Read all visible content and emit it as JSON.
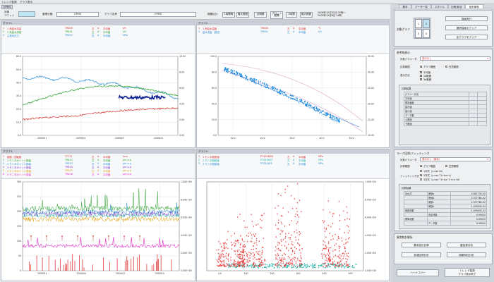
{
  "window": {
    "title": "トレンド監視 グラフ表示"
  },
  "menu": {
    "item1": "トレンド監視",
    "item2": "グラフ表示"
  },
  "tabs": [
    "基本",
    "データ一覧",
    "スタイル",
    "比較/組合",
    "統計解析"
  ],
  "toolbar": {
    "mode_label": "OPMS",
    "target_label1": "対象",
    "target_label2": "ユニット",
    "target_value": "",
    "group_label": "管理分類",
    "group_value": "OPMS",
    "graph_label": "グラフ名称",
    "graph_value": "OPMS",
    "period_label": "期間区分",
    "btn_1h": "1時間毎",
    "btn_latest": "最大範囲",
    "btn_all": "全期間",
    "btn_plot1": "プロット",
    "btn_plot2": "間隔",
    "btn_1h_b": "1時間",
    "btn_latest_b": "最大範囲",
    "date_from": "2008年12月31日 00時～",
    "date_to": "2009年12月8日 24時"
  },
  "graph1": {
    "title": "グラフ1",
    "legend": [
      {
        "no": "1",
        "name": "1 系給水流量",
        "code": "TR850",
        "axis": "左",
        "col": "A",
        "stat": "平均値",
        "unit": "t/h",
        "color": "#d0312d"
      },
      {
        "no": "2",
        "name": "2 系給水流量",
        "code": "TR851",
        "axis": "左",
        "col": "A",
        "stat": "平均値",
        "unit": "t/h",
        "color": "#2b9e2b"
      },
      {
        "no": "3",
        "name": "主蒸気圧力",
        "code": "TR852",
        "axis": "右",
        "col": "A",
        "stat": "平均値",
        "unit": "MPa",
        "color": "#2a8fd4"
      }
    ],
    "y_left": [
      "60.0",
      "50.0",
      "40.0",
      "30.0",
      "20.0",
      "10.0",
      "0.0"
    ],
    "y_right": [
      "10.00",
      "8.00",
      "6.00",
      "4.00",
      "2.00",
      "0.00"
    ],
    "x_ticks": [
      "2009/01",
      "2009/04",
      "2009/07",
      "2009/10"
    ]
  },
  "graph2": {
    "title": "グラフ2",
    "legend": [
      {
        "no": "1",
        "name": "1 系給水温度",
        "code": "TR800",
        "axis": "左",
        "col": "A",
        "stat": "平均値",
        "unit": "℃",
        "color": "#d0312d"
      },
      {
        "no": "2",
        "name": "給水流量（推定）",
        "code": "TR801",
        "axis": "左",
        "col": "A",
        "stat": "平均値",
        "unit": "t/h",
        "color": "#2a8fd4"
      }
    ],
    "y_left": [
      "100.0",
      "80.0",
      "60.0",
      "40.0",
      "20.0",
      "0.0"
    ],
    "y_right": [
      "35.00",
      "30.00",
      "25.00",
      "20.00",
      "15.00",
      "10.00"
    ],
    "x_ticks": [
      "10.0",
      "20.0",
      "30.0",
      "40.0",
      "50.0"
    ]
  },
  "graph3": {
    "title": "グラフ3",
    "legend": [
      {
        "no": "1",
        "name": "振動 / 回転数",
        "code": "TT727",
        "axis": "左",
        "col": "A",
        "stat": "平均値",
        "unit": "rpm",
        "color": "#d0312d"
      },
      {
        "no": "2",
        "name": "1 モニタポイント振幅",
        "code": "TR812",
        "axis": "左",
        "col": "A",
        "stat": "平均値",
        "unit": "μm p-p",
        "color": "#2b9e2b"
      },
      {
        "no": "3",
        "name": "2 モニタポイント振幅",
        "code": "TR813",
        "axis": "左",
        "col": "A",
        "stat": "平均値",
        "unit": "μm p-p",
        "color": "#2a8fd4"
      },
      {
        "no": "4",
        "name": "3 モニタポイント振幅",
        "code": "TR814",
        "axis": "左",
        "col": "A",
        "stat": "平均値",
        "unit": "μm p-p",
        "color": "#7a2ec9"
      },
      {
        "no": "5",
        "name": "4 モニタポイント振幅",
        "code": "TR815",
        "axis": "左",
        "col": "A",
        "stat": "平均値",
        "unit": "μm p-p",
        "color": "#e0a10e"
      },
      {
        "no": "6",
        "name": "5 モニタポイント振幅",
        "code": "TR816",
        "axis": "左",
        "col": "A",
        "stat": "平均値",
        "unit": "μm p-p",
        "color": "#e02fc7"
      }
    ],
    "y_left": [
      "300",
      "250",
      "200",
      "150",
      "100",
      "50",
      "0"
    ],
    "y_right": [
      "1.00E+04",
      "8.00E+03",
      "6.00E+03",
      "4.00E+03",
      "2.00E+03",
      "0.00E+00"
    ],
    "x_ticks": [
      "2009/01",
      "2009/04",
      "2009/07",
      "2009/10"
    ]
  },
  "graph4": {
    "title": "グラフ4",
    "legend": [
      {
        "no": "1",
        "name": "1 モニタ振動値",
        "code": "PT433ADD",
        "axis": "左",
        "col": "A",
        "stat": "平均値",
        "unit": "MPa",
        "color": "#d0312d"
      },
      {
        "no": "2",
        "name": "2 モニタ振動値",
        "code": "PT433AGT",
        "axis": "左",
        "col": "A",
        "stat": "平均値",
        "unit": "MPa",
        "color": "#1ab3a6"
      },
      {
        "no": "3",
        "name": "3 モニタ振動値",
        "code": "PT433AFF",
        "axis": "左",
        "col": "A",
        "stat": "平均値",
        "unit": "MPa",
        "color": "#2a8fd4"
      }
    ],
    "y_right": [
      "1.00E+04",
      "8.00E+03",
      "6.00E+03",
      "4.00E+03",
      "2.00E+03",
      "0.00E+00"
    ],
    "x_ticks": [
      "0.0",
      "100",
      "200",
      "300",
      "400",
      "500"
    ]
  },
  "right": {
    "target_graph_label": "対象グラフ",
    "graph_nums": [
      "1",
      "2",
      "3",
      "4"
    ],
    "btn_search": "描画実行",
    "btn_clear_sel": "選択描画をクリア",
    "btn_clear_all": "全グラフをクリア",
    "ref_title": "参考線表示",
    "ref_param_label": "対象パラメータ",
    "ref_param_value": "表示なし",
    "calc_label": "計算期間",
    "calc_opt1": "グラフ範囲",
    "calc_opt2": "任意期間",
    "method_label": "表示方法",
    "method_opt1": "平均値",
    "method_opt2": "2σ範囲",
    "method_opt3": "3σ範囲",
    "calc_result_title": "計算結果",
    "calc_rows": [
      [
        "パラメータ名",
        "",
        ""
      ],
      [
        "平均値",
        "",
        ""
      ],
      [
        "標準偏差",
        "",
        ""
      ],
      [
        "最大値",
        "",
        ""
      ],
      [
        "最小値",
        "",
        ""
      ],
      [
        "データ数",
        "",
        ""
      ],
      [
        "上限値",
        "",
        ""
      ],
      [
        "下限値",
        "",
        ""
      ]
    ],
    "fit_title": "ヨーク回帰/フィッティング",
    "fit_param_label": "対象パラメータ",
    "fit_param_value": "表示なし（無効）",
    "fit_calc_label": "計算期間",
    "fit_calc_opt1": "グラフ範囲",
    "fit_calc_opt2": "任意期間",
    "fit_method_label": "フィッティング式",
    "fit_method_opt1": "1次式（y=ax+b）",
    "fit_method_opt2": "2次式（y=ax^2+bx+c）",
    "fit_method_opt3": "3次式（y=ax^3+bx^2+cx+d）",
    "fit_result_title": "計算結果",
    "fit_rows": [
      [
        "近似式",
        "係数a",
        "-3.98773E-05"
      ],
      [
        "",
        "係数b",
        "2.33778E-02"
      ],
      [
        "",
        "係数c",
        "2.33778E-02"
      ],
      [
        "",
        "係数d",
        "1.05953E-03"
      ],
      [
        "相関係数",
        "",
        "1.05953E-03"
      ],
      [
        "",
        "決定係数",
        "0.99920"
      ],
      [
        "標準誤差",
        "",
        "0.99920"
      ],
      [
        "",
        "データ数",
        "0.99920"
      ]
    ],
    "stat_title": "異常統計解析",
    "btn_stat1": "基本統計計算",
    "btn_stat2": "重回帰分析",
    "btn_stat3": "多項回帰分析",
    "btn_stat4": "周期特性分析",
    "btn_hardcopy": "ハードコピー",
    "btn_trend1": "トレンド監視",
    "btn_trend2": "グラフ表示終了"
  }
}
